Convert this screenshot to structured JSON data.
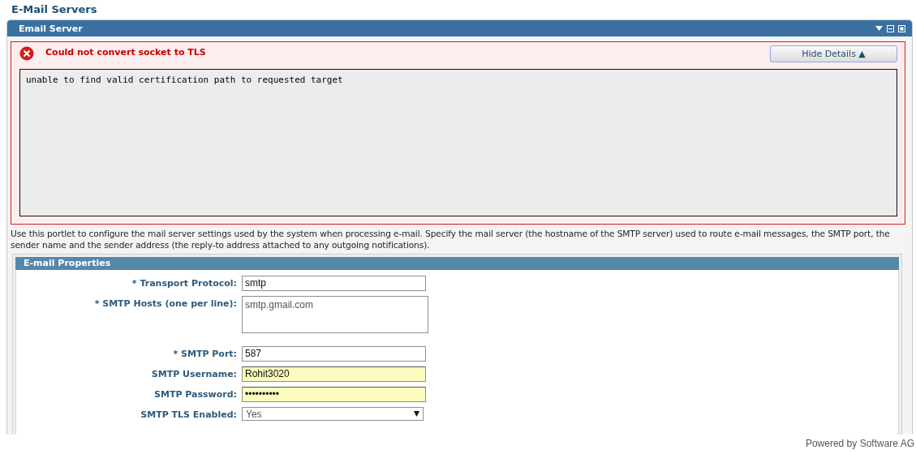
{
  "page_title": "E-Mail Servers",
  "portlet": {
    "title": "Email Server"
  },
  "error": {
    "message": "Could not convert socket to TLS",
    "toggle_label": "Hide Details ▲",
    "details": "unable to find valid certification path to requested target"
  },
  "description": "Use this portlet to configure the mail server settings used by the system when processing e-mail. Specify the mail server (the hostname of the SMTP server) used to route e-mail messages, the SMTP port, the sender name and the sender address (the reply-to address attached to any outgoing notifications).",
  "properties": {
    "title": "E-mail Properties",
    "fields": [
      {
        "kind": "text",
        "label": "* Transport Protocol:",
        "value": "smtp",
        "highlighted": false
      },
      {
        "kind": "textarea",
        "label": "* SMTP Hosts (one per line):",
        "value": "smtp.gmail.com",
        "highlighted": false
      },
      {
        "kind": "text",
        "label": "* SMTP Port:",
        "value": "587",
        "highlighted": false
      },
      {
        "kind": "text",
        "label": "SMTP Username:",
        "value": "Rohit3020",
        "highlighted": true
      },
      {
        "kind": "text",
        "label": "SMTP Password:",
        "value": "••••••••••",
        "highlighted": true
      },
      {
        "kind": "select",
        "label": "SMTP TLS Enabled:",
        "value": "Yes",
        "highlighted": false
      }
    ]
  },
  "footer": "Powered by Software AG"
}
